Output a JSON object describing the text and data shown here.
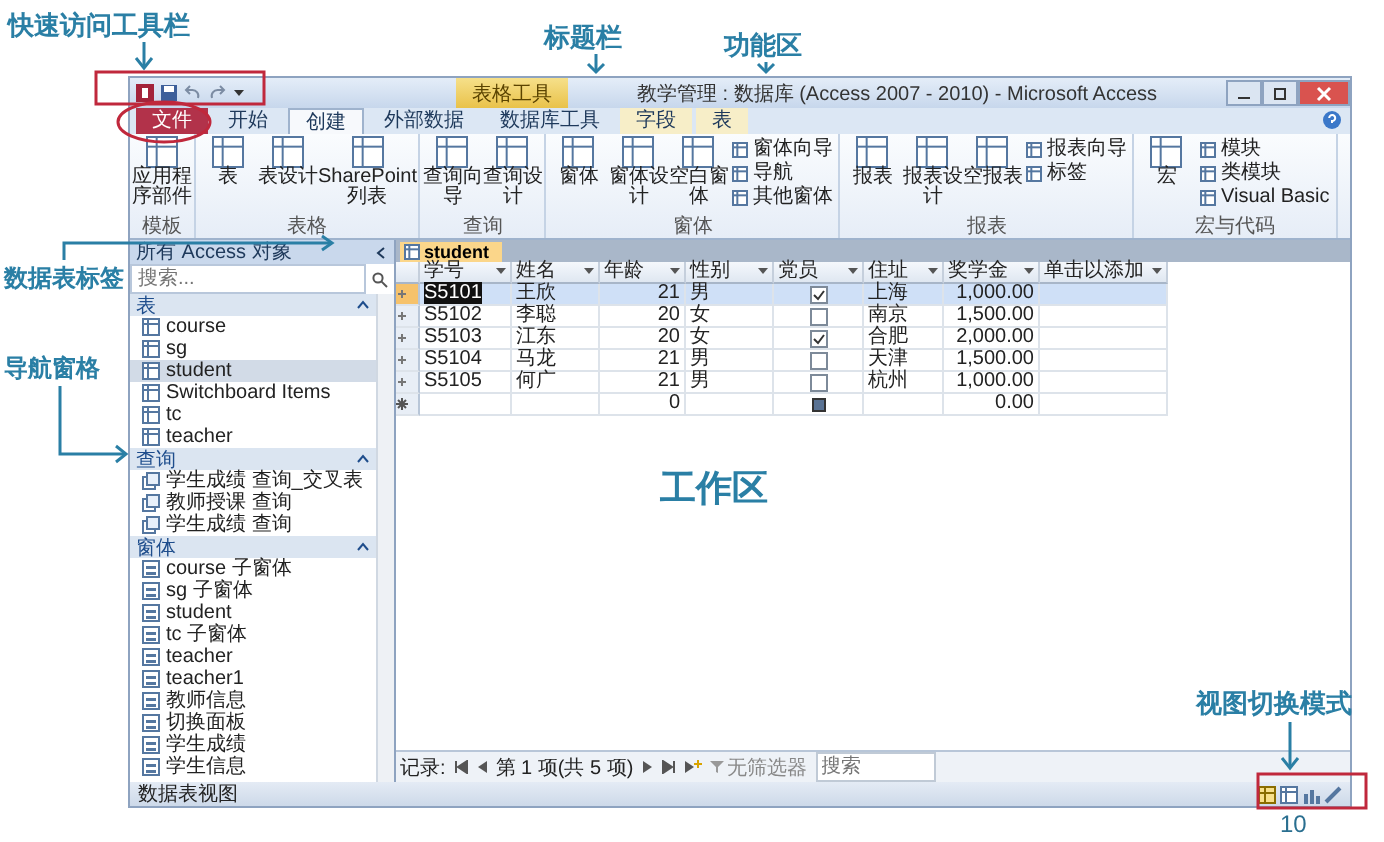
{
  "annotations": [
    "快速访问工具栏",
    "标题栏",
    "功能区",
    "数据表标签",
    "导航窗格",
    "工作区",
    "视图切换模式"
  ],
  "page_number": "10",
  "window": {
    "title": "教学管理 : 数据库 (Access 2007 - 2010) - Microsoft Access",
    "context_tab": "表格工具"
  },
  "ribbon_tabs": [
    {
      "label": "文件",
      "selected": false,
      "kind": "file"
    },
    {
      "label": "开始",
      "selected": false,
      "kind": "normal"
    },
    {
      "label": "创建",
      "selected": true,
      "kind": "normal"
    },
    {
      "label": "外部数据",
      "selected": false,
      "kind": "normal"
    },
    {
      "label": "数据库工具",
      "selected": false,
      "kind": "normal"
    },
    {
      "label": "字段",
      "selected": false,
      "kind": "context"
    },
    {
      "label": "表",
      "selected": false,
      "kind": "context"
    }
  ],
  "ribbon_groups": [
    {
      "name": "模板",
      "large": [
        "应用程序部件"
      ]
    },
    {
      "name": "表格",
      "large": [
        "表",
        "表设计",
        "SharePoint 列表"
      ]
    },
    {
      "name": "查询",
      "large": [
        "查询向导",
        "查询设计"
      ]
    },
    {
      "name": "窗体",
      "large": [
        "窗体",
        "窗体设计",
        "空白窗体"
      ],
      "small": [
        "窗体向导",
        "导航",
        "其他窗体"
      ]
    },
    {
      "name": "报表",
      "large": [
        "报表",
        "报表设计",
        "空报表"
      ],
      "small": [
        "报表向导",
        "标签"
      ]
    },
    {
      "name": "宏与代码",
      "large": [
        "宏"
      ],
      "small": [
        "模块",
        "类模块",
        "Visual Basic"
      ]
    }
  ],
  "nav_pane": {
    "title": "所有 Access 对象",
    "search": {
      "placeholder": "搜索..."
    },
    "groups": [
      {
        "name": "表",
        "kind": "table",
        "items": [
          {
            "label": "course",
            "selected": false
          },
          {
            "label": "sg",
            "selected": false
          },
          {
            "label": "student",
            "selected": true
          },
          {
            "label": "Switchboard Items",
            "selected": false
          },
          {
            "label": "tc",
            "selected": false
          },
          {
            "label": "teacher",
            "selected": false
          }
        ]
      },
      {
        "name": "查询",
        "kind": "query",
        "items": [
          {
            "label": "学生成绩 查询_交叉表",
            "selected": false
          },
          {
            "label": "教师授课 查询",
            "selected": false
          },
          {
            "label": "学生成绩 查询",
            "selected": false
          }
        ]
      },
      {
        "name": "窗体",
        "kind": "form",
        "items": [
          {
            "label": "course 子窗体",
            "selected": false
          },
          {
            "label": "sg 子窗体",
            "selected": false
          },
          {
            "label": "student",
            "selected": false
          },
          {
            "label": "tc 子窗体",
            "selected": false
          },
          {
            "label": "teacher",
            "selected": false
          },
          {
            "label": "teacher1",
            "selected": false
          },
          {
            "label": "教师信息",
            "selected": false
          },
          {
            "label": "切换面板",
            "selected": false
          },
          {
            "label": "学生成绩",
            "selected": false
          },
          {
            "label": "学生信息",
            "selected": false
          }
        ]
      }
    ]
  },
  "document_tab": "student",
  "table": {
    "columns": [
      "学号",
      "姓名",
      "年龄",
      "性别",
      "党员",
      "住址",
      "奖学金",
      "单击以添加"
    ],
    "rows": [
      {
        "id": "S5101",
        "name": "王欣",
        "age": "21",
        "sex": "男",
        "party_member": true,
        "address": "上海",
        "scholarship": "1,000.00",
        "selected": true
      },
      {
        "id": "S5102",
        "name": "李聪",
        "age": "20",
        "sex": "女",
        "party_member": false,
        "address": "南京",
        "scholarship": "1,500.00",
        "selected": false
      },
      {
        "id": "S5103",
        "name": "江东",
        "age": "20",
        "sex": "女",
        "party_member": true,
        "address": "合肥",
        "scholarship": "2,000.00",
        "selected": false
      },
      {
        "id": "S5104",
        "name": "马龙",
        "age": "21",
        "sex": "男",
        "party_member": false,
        "address": "天津",
        "scholarship": "1,500.00",
        "selected": false
      },
      {
        "id": "S5105",
        "name": "何广",
        "age": "21",
        "sex": "男",
        "party_member": false,
        "address": "杭州",
        "scholarship": "1,000.00",
        "selected": false
      }
    ],
    "new_row": {
      "age": "0",
      "scholarship": "0.00"
    }
  },
  "record_nav": {
    "label": "记录:",
    "position": "第 1 项(共 5 项)",
    "filter": "无筛选器",
    "search": {
      "placeholder": "搜索"
    }
  },
  "status_bar": {
    "text": "数据表视图"
  }
}
